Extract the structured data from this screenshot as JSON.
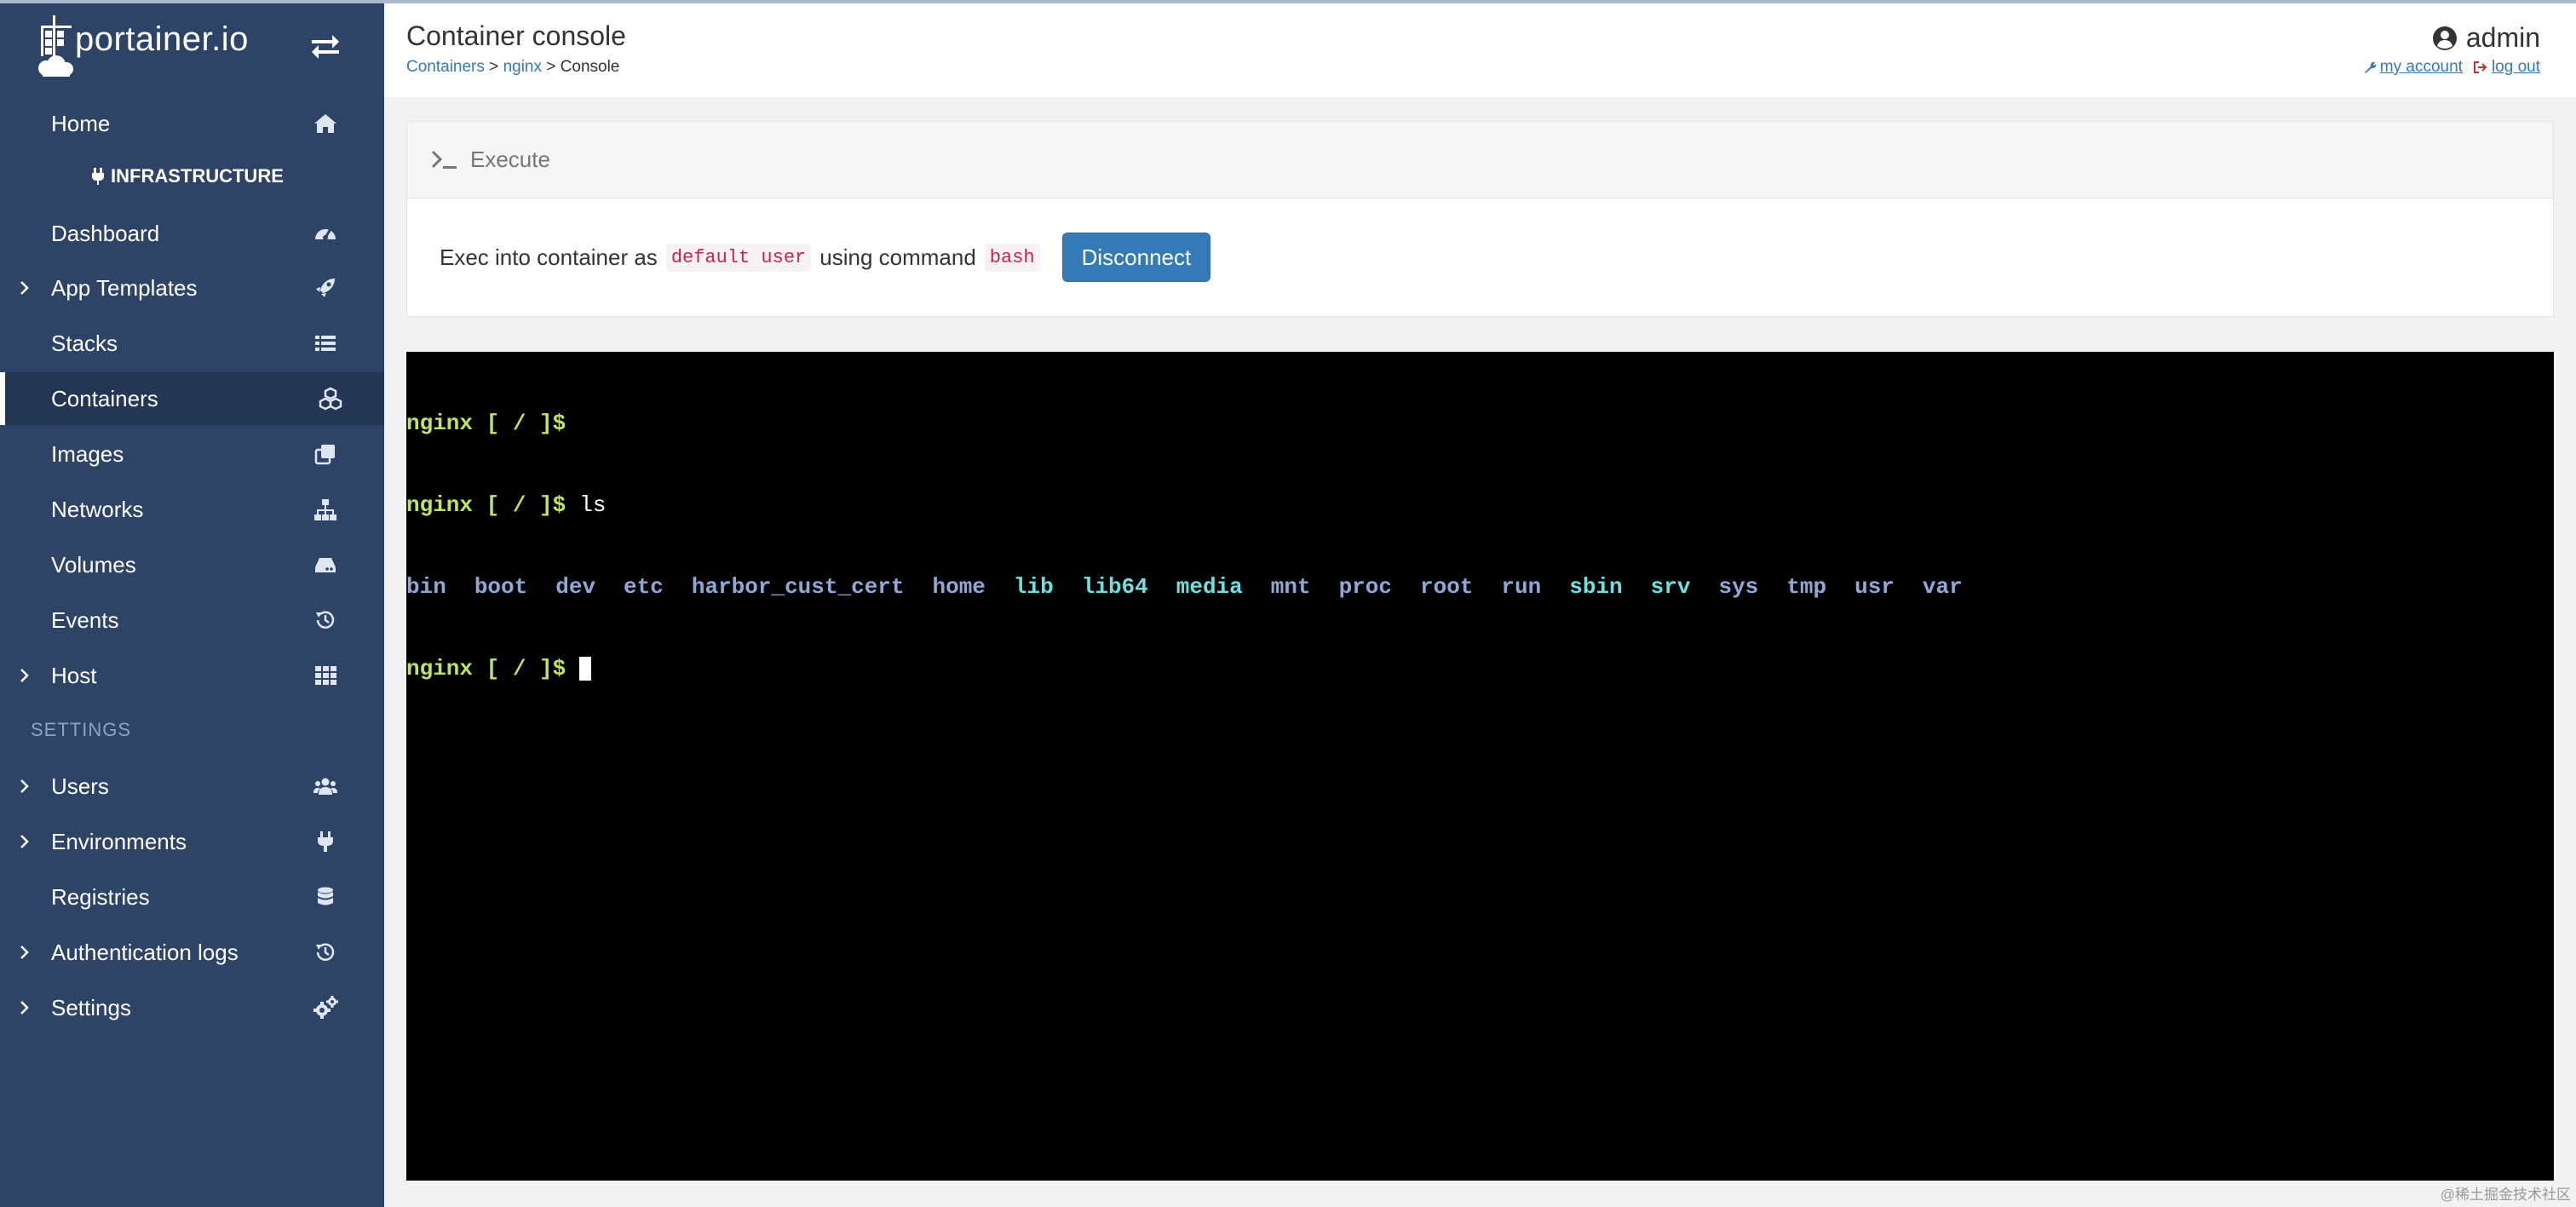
{
  "brand": {
    "name": "portainer.io"
  },
  "sidebar": {
    "home": "Home",
    "infrastructure_header": "INFRASTRUCTURE",
    "items": [
      {
        "label": "Dashboard",
        "icon": "dashboard-icon"
      },
      {
        "label": "App Templates",
        "icon": "rocket-icon",
        "expandable": true
      },
      {
        "label": "Stacks",
        "icon": "list-icon"
      },
      {
        "label": "Containers",
        "icon": "cubes-icon",
        "active": true
      },
      {
        "label": "Images",
        "icon": "clone-icon"
      },
      {
        "label": "Networks",
        "icon": "sitemap-icon"
      },
      {
        "label": "Volumes",
        "icon": "hdd-icon"
      },
      {
        "label": "Events",
        "icon": "history-icon"
      },
      {
        "label": "Host",
        "icon": "th-icon",
        "expandable": true
      }
    ],
    "settings_header": "SETTINGS",
    "settings_items": [
      {
        "label": "Users",
        "icon": "users-icon",
        "expandable": true
      },
      {
        "label": "Environments",
        "icon": "plug-icon",
        "expandable": true
      },
      {
        "label": "Registries",
        "icon": "database-icon"
      },
      {
        "label": "Authentication logs",
        "icon": "history-icon",
        "expandable": true
      },
      {
        "label": "Settings",
        "icon": "cogs-icon",
        "expandable": true
      }
    ]
  },
  "header": {
    "title": "Container console",
    "breadcrumb": {
      "containers": "Containers",
      "nginx": "nginx",
      "current": "Console",
      "sep": ">"
    },
    "user": "admin",
    "my_account": "my account",
    "log_out": "log out"
  },
  "execute": {
    "title": "Execute",
    "text_prefix": "Exec into container as",
    "user": "default user",
    "text_middle": "using command",
    "command": "bash",
    "button": "Disconnect"
  },
  "terminal": {
    "prompt": "nginx [ / ]$",
    "command": "ls",
    "ls_output": [
      {
        "name": "bin",
        "color": "#8fa9d6"
      },
      {
        "name": "boot",
        "color": "#8fa9d6"
      },
      {
        "name": "dev",
        "color": "#8fa9d6"
      },
      {
        "name": "etc",
        "color": "#8fa9d6"
      },
      {
        "name": "harbor_cust_cert",
        "color": "#8fa9d6"
      },
      {
        "name": "home",
        "color": "#8fa9d6"
      },
      {
        "name": "lib",
        "color": "#6fe0e0"
      },
      {
        "name": "lib64",
        "color": "#6fe0e0"
      },
      {
        "name": "media",
        "color": "#6fe0e0"
      },
      {
        "name": "mnt",
        "color": "#8fa9d6"
      },
      {
        "name": "proc",
        "color": "#8fa9d6"
      },
      {
        "name": "root",
        "color": "#8fa9d6"
      },
      {
        "name": "run",
        "color": "#8fa9d6"
      },
      {
        "name": "sbin",
        "color": "#6fe0e0"
      },
      {
        "name": "srv",
        "color": "#6fe0e0"
      },
      {
        "name": "sys",
        "color": "#8fa9d6"
      },
      {
        "name": "tmp",
        "color": "#8fa9d6"
      },
      {
        "name": "usr",
        "color": "#8fa9d6"
      },
      {
        "name": "var",
        "color": "#8fa9d6"
      }
    ]
  },
  "watermark": "@稀土掘金技术社区"
}
